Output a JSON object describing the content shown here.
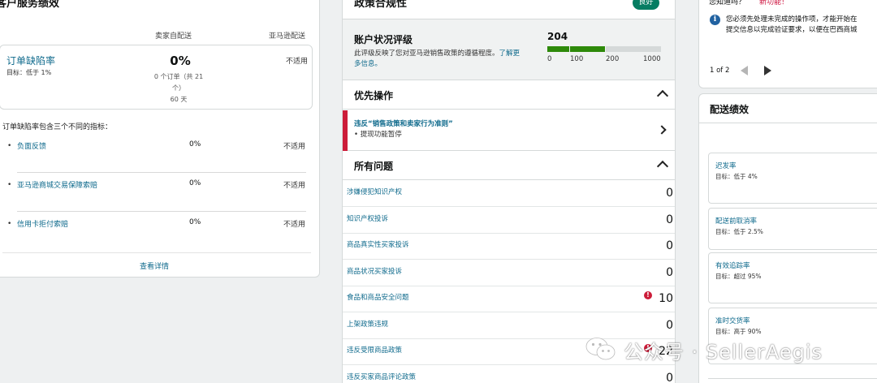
{
  "left_card": {
    "title": "客户服务绩效",
    "col_self": "卖家自配送",
    "col_amazon": "亚马逊配送",
    "odr": {
      "name": "订单缺陷率",
      "target": "目标：低于 1%",
      "value": "0%",
      "detail_line1": "0 个订单（共 21",
      "detail_line2": "个）",
      "detail_line3": "60 天",
      "amazon": "不适用"
    },
    "note": "订单缺陷率包含三个不同的指标：",
    "sub_metrics": [
      {
        "name": "负面反馈",
        "value": "0%",
        "amazon": "不适用"
      },
      {
        "name": "亚马逊商城交易保障索赔",
        "value": "0%",
        "amazon": "不适用"
      },
      {
        "name": "信用卡拒付索赔",
        "value": "0%",
        "amazon": "不适用"
      }
    ],
    "footer_link": "查看详情"
  },
  "middle_card": {
    "title": "政策合规性",
    "badge": "良好",
    "account_health": {
      "title": "账户状况评级",
      "desc_prefix": "此评级反映了您对亚马逊销售政策的遵循程度。",
      "desc_link": "了解更多信息。",
      "score": "204",
      "score_value": 204,
      "scale_max": 1000,
      "ticks": [
        "0",
        "100",
        "200",
        "1000"
      ],
      "colors": {
        "good": "#2e8a0a",
        "rest": "#d5d9d9"
      }
    },
    "priority": {
      "title": "优先操作",
      "item_title": "违反“销售政策和卖家行为准则”",
      "item_sub": "• 提现功能暂停"
    },
    "all_issues": {
      "title": "所有问题",
      "items": [
        {
          "name": "涉嫌侵犯知识产权",
          "count": "0",
          "alert": false
        },
        {
          "name": "知识产权投诉",
          "count": "0",
          "alert": false
        },
        {
          "name": "商品真实性买家投诉",
          "count": "0",
          "alert": false
        },
        {
          "name": "商品状况买家投诉",
          "count": "0",
          "alert": false
        },
        {
          "name": "食品和商品安全问题",
          "count": "10",
          "alert": true
        },
        {
          "name": "上架政策违规",
          "count": "0",
          "alert": false
        },
        {
          "name": "违反受限商品政策",
          "count": "22",
          "alert": true
        },
        {
          "name": "违反买家商品评论政策",
          "count": "0",
          "alert": false
        }
      ],
      "alert_symbol": "!"
    }
  },
  "right_top": {
    "question": "您知道吗？",
    "new_feature": "新功能！",
    "info_symbol": "i",
    "message_line1": "您必须先处理未完成的操作项，才能开始在",
    "message_line2": "提交信息以完成验证要求，以便在巴西商城",
    "page": "1 of 2"
  },
  "right_bottom": {
    "title": "配送绩效",
    "metrics": [
      {
        "name": "迟发率",
        "target": "目标：低于 4%"
      },
      {
        "name": "配送前取消率",
        "target": "目标：低于 2.5%"
      },
      {
        "name": "有效追踪率",
        "target": "目标：超过 95%"
      },
      {
        "name": "准时交货率",
        "target": "目标：高于 90%"
      }
    ]
  },
  "watermark": {
    "text": "公众号 · SellerAegis"
  }
}
